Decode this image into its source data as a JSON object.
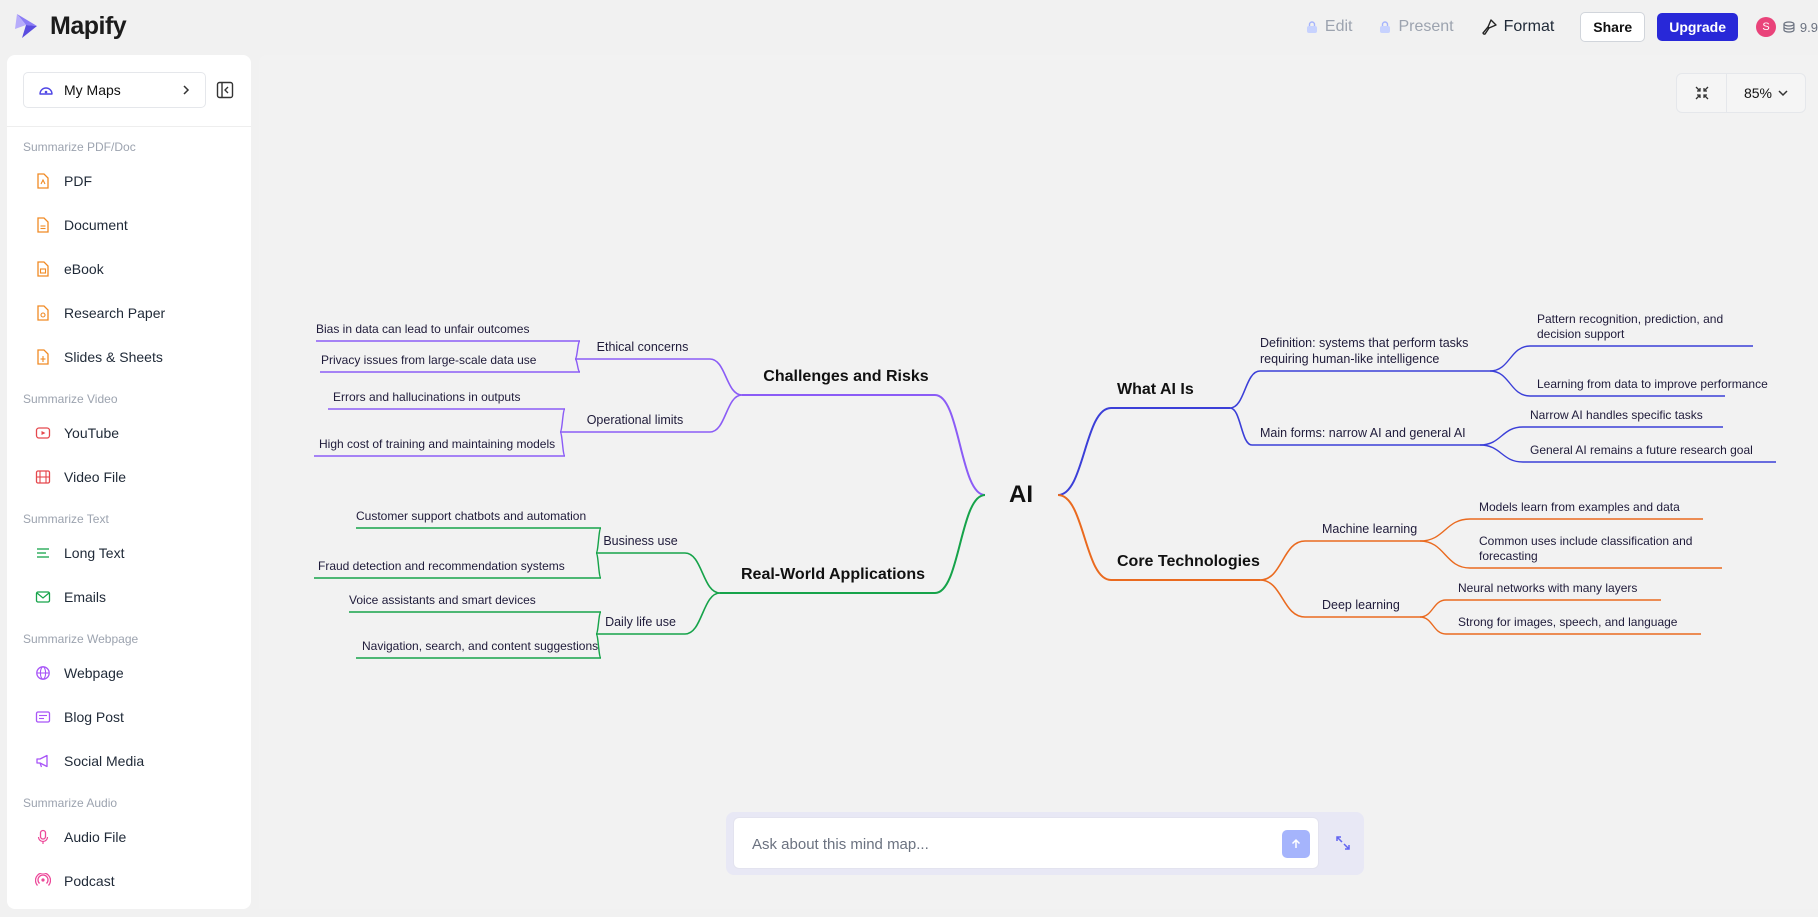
{
  "app": {
    "name": "Mapify"
  },
  "header": {
    "edit_label": "Edit",
    "present_label": "Present",
    "format_label": "Format",
    "share_label": "Share",
    "upgrade_label": "Upgrade",
    "avatar_initial": "S",
    "credits": "9.9"
  },
  "sidebar": {
    "my_maps_label": "My Maps",
    "sections": [
      {
        "title": "Summarize PDF/Doc",
        "items": [
          {
            "label": "PDF",
            "icon": "pdf-file-icon",
            "color": "#f08a24"
          },
          {
            "label": "Document",
            "icon": "document-file-icon",
            "color": "#f08a24"
          },
          {
            "label": "eBook",
            "icon": "ebook-file-icon",
            "color": "#f08a24"
          },
          {
            "label": "Research Paper",
            "icon": "research-paper-icon",
            "color": "#f08a24"
          },
          {
            "label": "Slides & Sheets",
            "icon": "slides-sheets-icon",
            "color": "#f08a24"
          }
        ]
      },
      {
        "title": "Summarize Video",
        "items": [
          {
            "label": "YouTube",
            "icon": "youtube-icon",
            "color": "#e5484d"
          },
          {
            "label": "Video File",
            "icon": "video-file-icon",
            "color": "#e5484d"
          }
        ]
      },
      {
        "title": "Summarize Text",
        "items": [
          {
            "label": "Long Text",
            "icon": "long-text-icon",
            "color": "#16a34a"
          },
          {
            "label": "Emails",
            "icon": "email-icon",
            "color": "#16a34a"
          }
        ]
      },
      {
        "title": "Summarize Webpage",
        "items": [
          {
            "label": "Webpage",
            "icon": "globe-icon",
            "color": "#a855f7"
          },
          {
            "label": "Blog Post",
            "icon": "blog-post-icon",
            "color": "#a855f7"
          },
          {
            "label": "Social Media",
            "icon": "megaphone-icon",
            "color": "#a855f7"
          }
        ]
      },
      {
        "title": "Summarize Audio",
        "items": [
          {
            "label": "Audio File",
            "icon": "microphone-icon",
            "color": "#ec4899"
          },
          {
            "label": "Podcast",
            "icon": "podcast-icon",
            "color": "#ec4899"
          }
        ]
      }
    ]
  },
  "canvas": {
    "zoom_label": "85%"
  },
  "mindmap": {
    "root": "AI",
    "colors": {
      "purple": "#8b5cf6",
      "blue": "#3b3fd8",
      "green": "#16a34a",
      "orange": "#ea6a1f"
    },
    "branches": [
      {
        "label": "Challenges and Risks",
        "side": "left",
        "color": "#8b5cf6",
        "children": [
          {
            "label": "Ethical concerns",
            "children": [
              "Bias in data can lead to unfair outcomes",
              "Privacy issues from large-scale data use"
            ]
          },
          {
            "label": "Operational limits",
            "children": [
              "Errors and hallucinations in outputs",
              "High cost of training and maintaining models"
            ]
          }
        ]
      },
      {
        "label": "Real-World Applications",
        "side": "left",
        "color": "#16a34a",
        "children": [
          {
            "label": "Business use",
            "children": [
              "Customer support chatbots and automation",
              "Fraud detection and recommendation systems"
            ]
          },
          {
            "label": "Daily life use",
            "children": [
              "Voice assistants and smart devices",
              "Navigation, search, and content suggestions"
            ]
          }
        ]
      },
      {
        "label": "What AI Is",
        "side": "right",
        "color": "#3b3fd8",
        "children": [
          {
            "label": "Definition: systems that perform tasks requiring human-like intelligence",
            "children": [
              "Pattern recognition, prediction, and decision support",
              "Learning from data to improve performance"
            ]
          },
          {
            "label": "Main forms: narrow AI and general AI",
            "children": [
              "Narrow AI handles specific tasks",
              "General AI remains a future research goal"
            ]
          }
        ]
      },
      {
        "label": "Core Technologies",
        "side": "right",
        "color": "#ea6a1f",
        "children": [
          {
            "label": "Machine learning",
            "children": [
              "Models learn from examples and data",
              "Common uses include classification and forecasting"
            ]
          },
          {
            "label": "Deep learning",
            "children": [
              "Neural networks with many layers",
              "Strong for images, speech, and language"
            ]
          }
        ]
      }
    ]
  },
  "ask": {
    "placeholder": "Ask about this mind map..."
  }
}
